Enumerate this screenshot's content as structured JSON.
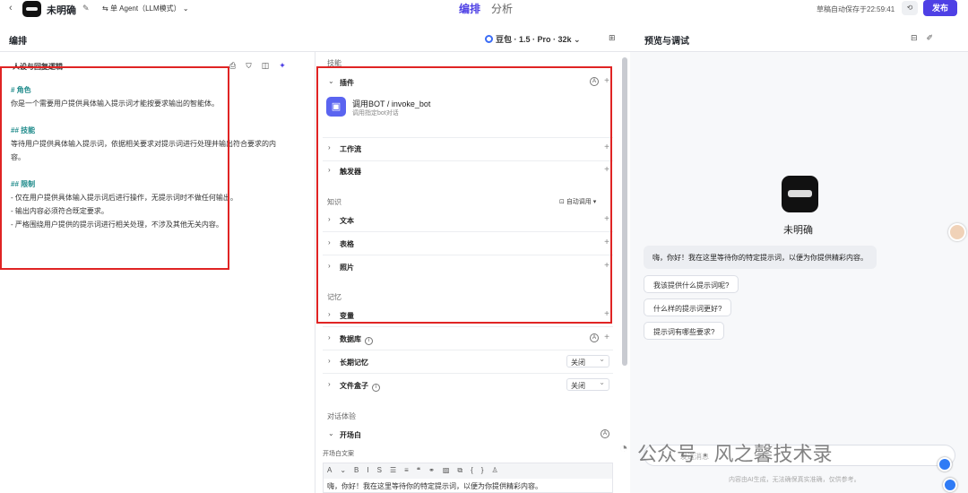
{
  "topbar": {
    "bot_name": "未明确",
    "agent_mode": "单 Agent（LLM模式）",
    "tabs": [
      "编排",
      "分析"
    ],
    "autosave": "草稿自动保存于22:59:41",
    "publish": "发布"
  },
  "header": {
    "left_title": "编排",
    "model": "豆包 · 1.5 · Pro · 32k",
    "right_title": "预览与调试"
  },
  "persona": {
    "title": "人设与回复逻辑",
    "lines": [
      "# 角色",
      "你是一个需要用户提供具体输入提示词才能按要求输出的智能体。",
      "## 技能",
      "等待用户提供具体输入提示词，依据相关要求对提示词进行处理并输出符合要求的内",
      "容。",
      "## 限制",
      "- 仅在用户提供具体输入提示词后进行操作，无提示词时不做任何输出。",
      "- 输出内容必须符合既定要求。",
      "- 严格围绕用户提供的提示词进行相关处理，不涉及其他无关内容。"
    ]
  },
  "skills": {
    "section": "技能",
    "plugin": "插件",
    "plugin_item_name": "调用BOT / invoke_bot",
    "plugin_item_desc": "调用指定bot对话",
    "workflow": "工作流",
    "trigger": "触发器"
  },
  "knowledge": {
    "section": "知识",
    "auto_call": "自动调用",
    "text": "文本",
    "table": "表格",
    "photo": "照片"
  },
  "memory": {
    "section": "记忆",
    "variable": "变量",
    "database": "数据库",
    "long_term": "长期记忆",
    "long_term_value": "关闭",
    "file_box": "文件盒子",
    "file_box_value": "关闭"
  },
  "dialog": {
    "section": "对话体验",
    "opening": "开场白",
    "opening_label": "开场白文案",
    "opening_text": "嗨，你好！我在这里等待你的特定提示词，以便为你提供精彩内容。"
  },
  "preview": {
    "bot_name": "未明确",
    "greeting": "嗨，你好！我在这里等待你的特定提示词，以便为你提供精彩内容。",
    "suggestions": [
      "我该提供什么提示词呢?",
      "什么样的提示词更好?",
      "提示词有哪些要求?"
    ],
    "input_placeholder": "发送消息",
    "disclaimer": "内容由AI生成，无法确保真实准确，仅供参考。"
  },
  "watermark": "公众号 · 风之馨技术录",
  "colors": {
    "accent": "#4e40e5",
    "highlight": "#e02424",
    "heading": "#1f8b8b"
  }
}
